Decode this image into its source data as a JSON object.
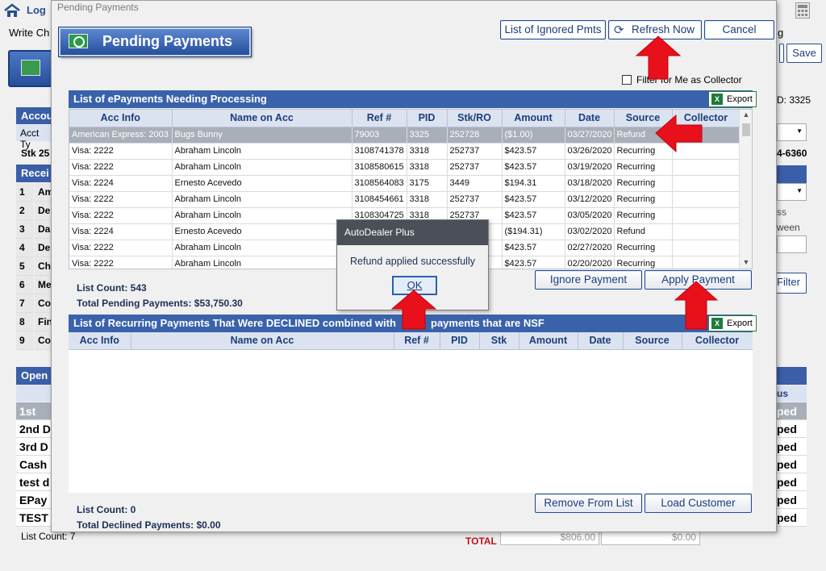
{
  "background": {
    "top_left_link": "Log",
    "write_label": "Write Ch",
    "right_label_g": "g",
    "save_label": "Save",
    "acct_label": "Accou",
    "acct_type_label": "Acct Ty",
    "stk_label": "Stk 25",
    "id_label": "D: 3325",
    "phone_partial": "4-6360",
    "receipts_label": "Recei",
    "side_items": [
      "Am",
      "De",
      "Da",
      "De",
      "Ch",
      "Me",
      "Co",
      "Fin",
      "Co"
    ],
    "side_numbers": [
      "1",
      "2",
      "3",
      "4",
      "5",
      "6",
      "7",
      "8",
      "9"
    ],
    "right_ss": "ss",
    "right_ween": "ween",
    "filter_label": "Filter",
    "open_label": "Open",
    "declined_items": [
      "1st De",
      "2nd D",
      "3rd D",
      "Cash",
      "test d",
      "EPay",
      "TEST"
    ],
    "right_status_header": "us",
    "right_status_items": [
      "ped",
      "ped",
      "ped",
      "ped",
      "ped",
      "ped",
      "ped"
    ],
    "list_count": "List Count:  7",
    "total_label": "TOTAL",
    "total_1": "$806.00",
    "total_2": "$0.00"
  },
  "dialog": {
    "title": "Pending Payments",
    "banner": "Pending Payments",
    "buttons": {
      "ignored": "List of Ignored Pmts",
      "refresh": "Refresh Now",
      "cancel": "Cancel",
      "ignore_payment": "Ignore Payment",
      "apply_payment": "Apply Payment",
      "remove_from_list": "Remove From List",
      "load_customer": "Load Customer"
    },
    "filter_checkbox": "Filter for Me as Collector",
    "export_label": "Export",
    "epayments": {
      "header": "List of ePayments Needing Processing",
      "columns": [
        "Acc Info",
        "Name on Acc",
        "Ref #",
        "PID",
        "Stk/RO",
        "Amount",
        "Date",
        "Source",
        "Collector"
      ],
      "rows": [
        [
          "American Express: 2003",
          "Bugs Bunny",
          "79003",
          "3325",
          "252728",
          "($1.00)",
          "03/27/2020",
          "Refund",
          ""
        ],
        [
          "Visa: 2222",
          "Abraham Lincoln",
          "3108741378",
          "3318",
          "252737",
          "$423.57",
          "03/26/2020",
          "Recurring",
          ""
        ],
        [
          "Visa: 2222",
          "Abraham Lincoln",
          "3108580615",
          "3318",
          "252737",
          "$423.57",
          "03/19/2020",
          "Recurring",
          ""
        ],
        [
          "Visa: 2224",
          "Ernesto Acevedo",
          "3108564083",
          "3175",
          "3449",
          "$194.31",
          "03/18/2020",
          "Recurring",
          ""
        ],
        [
          "Visa: 2222",
          "Abraham Lincoln",
          "3108454661",
          "3318",
          "252737",
          "$423.57",
          "03/12/2020",
          "Recurring",
          ""
        ],
        [
          "Visa: 2222",
          "Abraham Lincoln",
          "3108304725",
          "3318",
          "252737",
          "$423.57",
          "03/05/2020",
          "Recurring",
          ""
        ],
        [
          "Visa: 2224",
          "Ernesto Acevedo",
          "",
          "",
          "",
          "($194.31)",
          "03/02/2020",
          "Refund",
          ""
        ],
        [
          "Visa: 2222",
          "Abraham Lincoln",
          "",
          "",
          "",
          "$423.57",
          "02/27/2020",
          "Recurring",
          ""
        ],
        [
          "Visa: 2222",
          "Abraham Lincoln",
          "",
          "",
          "",
          "$423.57",
          "02/20/2020",
          "Recurring",
          ""
        ]
      ],
      "list_count": "List Count: 543",
      "total": "Total Pending Payments: $53,750.30"
    },
    "declined": {
      "header_left": "List of Recurring Payments That Were DECLINED combined with",
      "header_right": "payments that are NSF",
      "columns": [
        "Acc Info",
        "Name on Acc",
        "Ref #",
        "PID",
        "Stk",
        "Amount",
        "Date",
        "Source",
        "Collector"
      ],
      "list_count": "List Count: 0",
      "total": "Total Declined Payments: $0.00"
    }
  },
  "alert": {
    "title": "AutoDealer Plus",
    "message": "Refund applied successfully",
    "ok_label": "OK"
  },
  "colors": {
    "header_blue": "#3a62ab",
    "annotation_red": "#e8101a"
  }
}
